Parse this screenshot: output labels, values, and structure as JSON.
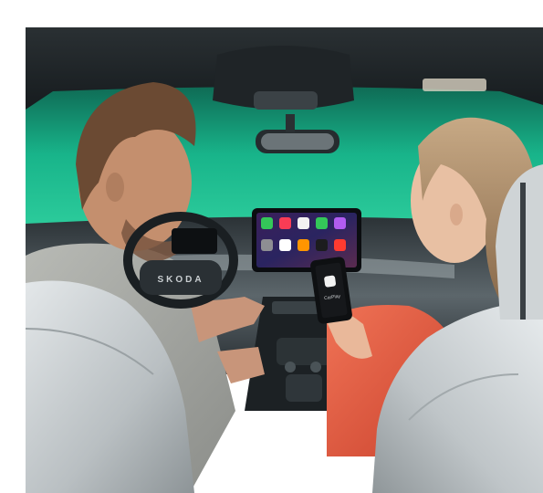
{
  "photo": {
    "steering_badge": "SKODA",
    "phone_screen_text": "CarPlay",
    "colors": {
      "windshield": "#19b88c",
      "cabin_dark": "#1b2024",
      "seat": "#cfd4d6",
      "woman_top": "#e4593f",
      "man_sweater": "#a8aaa6"
    },
    "screen_apps": [
      {
        "icon": "phone-app-icon",
        "color": "#34c759"
      },
      {
        "icon": "music-app-icon",
        "color": "#fa3c55"
      },
      {
        "icon": "maps-app-icon",
        "color": "#f2f2f2"
      },
      {
        "icon": "messages-app-icon",
        "color": "#34c759"
      },
      {
        "icon": "podcasts-app-icon",
        "color": "#b15cf0"
      },
      {
        "icon": "settings-app-icon",
        "color": "#8e8e93"
      },
      {
        "icon": "calendar-app-icon",
        "color": "#ffffff"
      },
      {
        "icon": "books-app-icon",
        "color": "#ff9500"
      },
      {
        "icon": "clock-app-icon",
        "color": "#1c1c1e"
      },
      {
        "icon": "news-app-icon",
        "color": "#ff3b30"
      }
    ]
  }
}
